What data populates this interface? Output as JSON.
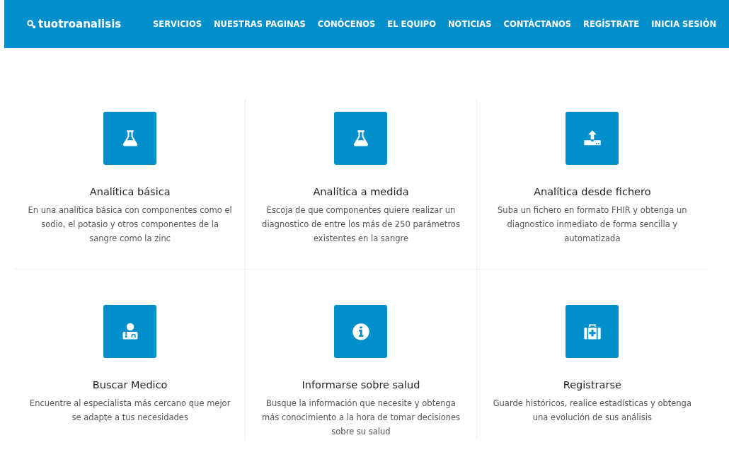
{
  "brand": "tuotroanalisis",
  "nav": [
    {
      "label": "SERVICIOS"
    },
    {
      "label": "NUESTRAS PAGINAS"
    },
    {
      "label": "CONÓCENOS"
    },
    {
      "label": "EL EQUIPO"
    },
    {
      "label": "NOTICIAS"
    },
    {
      "label": "CONTÁCTANOS"
    },
    {
      "label": "REGÍSTRATE"
    },
    {
      "label": "INICIA SESIÓN"
    }
  ],
  "services": [
    {
      "kind": "flask",
      "title": "Analítica básica",
      "description": "En una analítica básica con componentes como el sodio, el potasio y otros componentes de la sangre como la zinc"
    },
    {
      "kind": "flask",
      "title": "Analítica a medida",
      "description": "Escoja de que componentes quiere realizar un diagnostico de entre los más de 250 parámetros existentes en la sangre"
    },
    {
      "kind": "upload",
      "title": "Analítica desde fichero",
      "description": "Suba un fichero en formato FHIR y obtenga un diagnostico inmediato de forma sencilla y automatizada"
    },
    {
      "kind": "doctor",
      "title": "Buscar Medico",
      "description": "Encuentre al especialista más cercano que mejor se adapte a tus necesidades"
    },
    {
      "kind": "info",
      "title": "Informarse sobre salud",
      "description": "Busque la información que necesite y obtenga más conocimiento a la hora de tomar decisiones sobre su salud"
    },
    {
      "kind": "medkit",
      "title": "Registrarse",
      "description": "Guarde históricos, realice estadísticas y obtenga una evolución de sus análisis"
    }
  ]
}
